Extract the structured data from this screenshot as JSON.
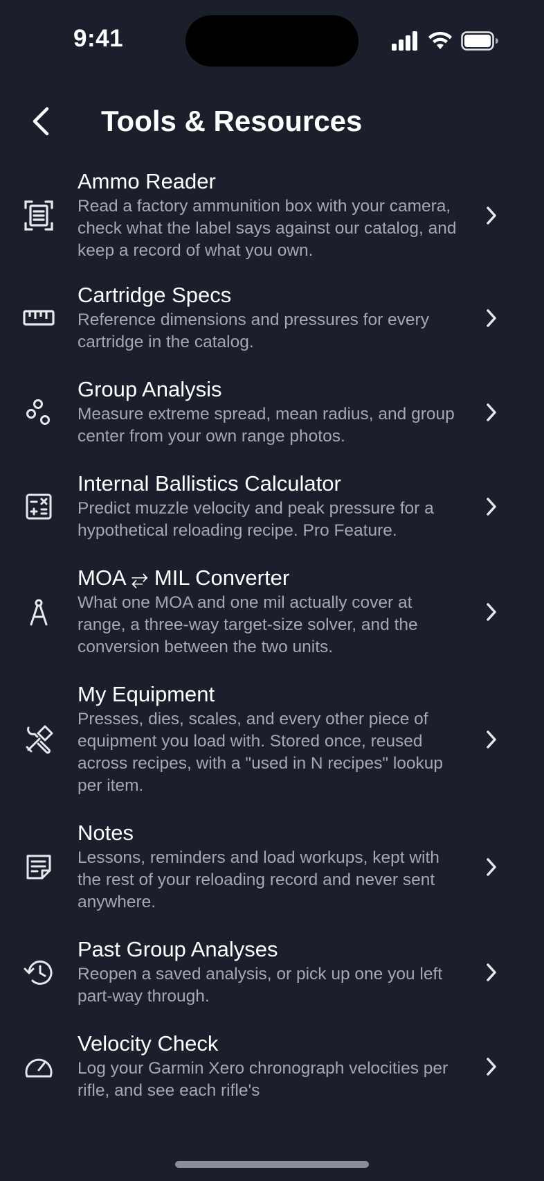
{
  "status": {
    "time": "9:41"
  },
  "nav": {
    "title": "Tools & Resources"
  },
  "items": [
    {
      "icon": "scan-document-icon",
      "title": "Ammo Reader",
      "description": "Read a factory ammunition box with your camera, check what the label says against our catalog, and keep a record of what you own."
    },
    {
      "icon": "ruler-icon",
      "title": "Cartridge Specs",
      "description": "Reference dimensions and pressures for every cartridge in the catalog."
    },
    {
      "icon": "scatter-circles-icon",
      "title": "Group Analysis",
      "description": "Measure extreme spread, mean radius, and group center from your own range photos."
    },
    {
      "icon": "calculator-icon",
      "title": "Internal Ballistics Calculator",
      "description": "Predict muzzle velocity and peak pressure for a hypothetical reloading recipe. Pro Feature."
    },
    {
      "icon": "compass-drafting-icon",
      "title": "MOA ⥂ MIL Converter",
      "description": "What one MOA and one mil actually cover at range, a three-way target-size solver, and the conversion between the two units."
    },
    {
      "icon": "tools-icon",
      "title": "My Equipment",
      "description": "Presses, dies, scales, and every other piece of equipment you load with. Stored once, reused across recipes, with a \"used in N recipes\" lookup per item."
    },
    {
      "icon": "note-icon",
      "title": "Notes",
      "description": "Lessons, reminders and load workups, kept with the rest of your reloading record and never sent anywhere."
    },
    {
      "icon": "history-icon",
      "title": "Past Group Analyses",
      "description": "Reopen a saved analysis, or pick up one you left part-way through."
    },
    {
      "icon": "speedometer-icon",
      "title": "Velocity Check",
      "description": "Log your Garmin Xero chronograph velocities per rifle, and see each rifle's"
    }
  ]
}
